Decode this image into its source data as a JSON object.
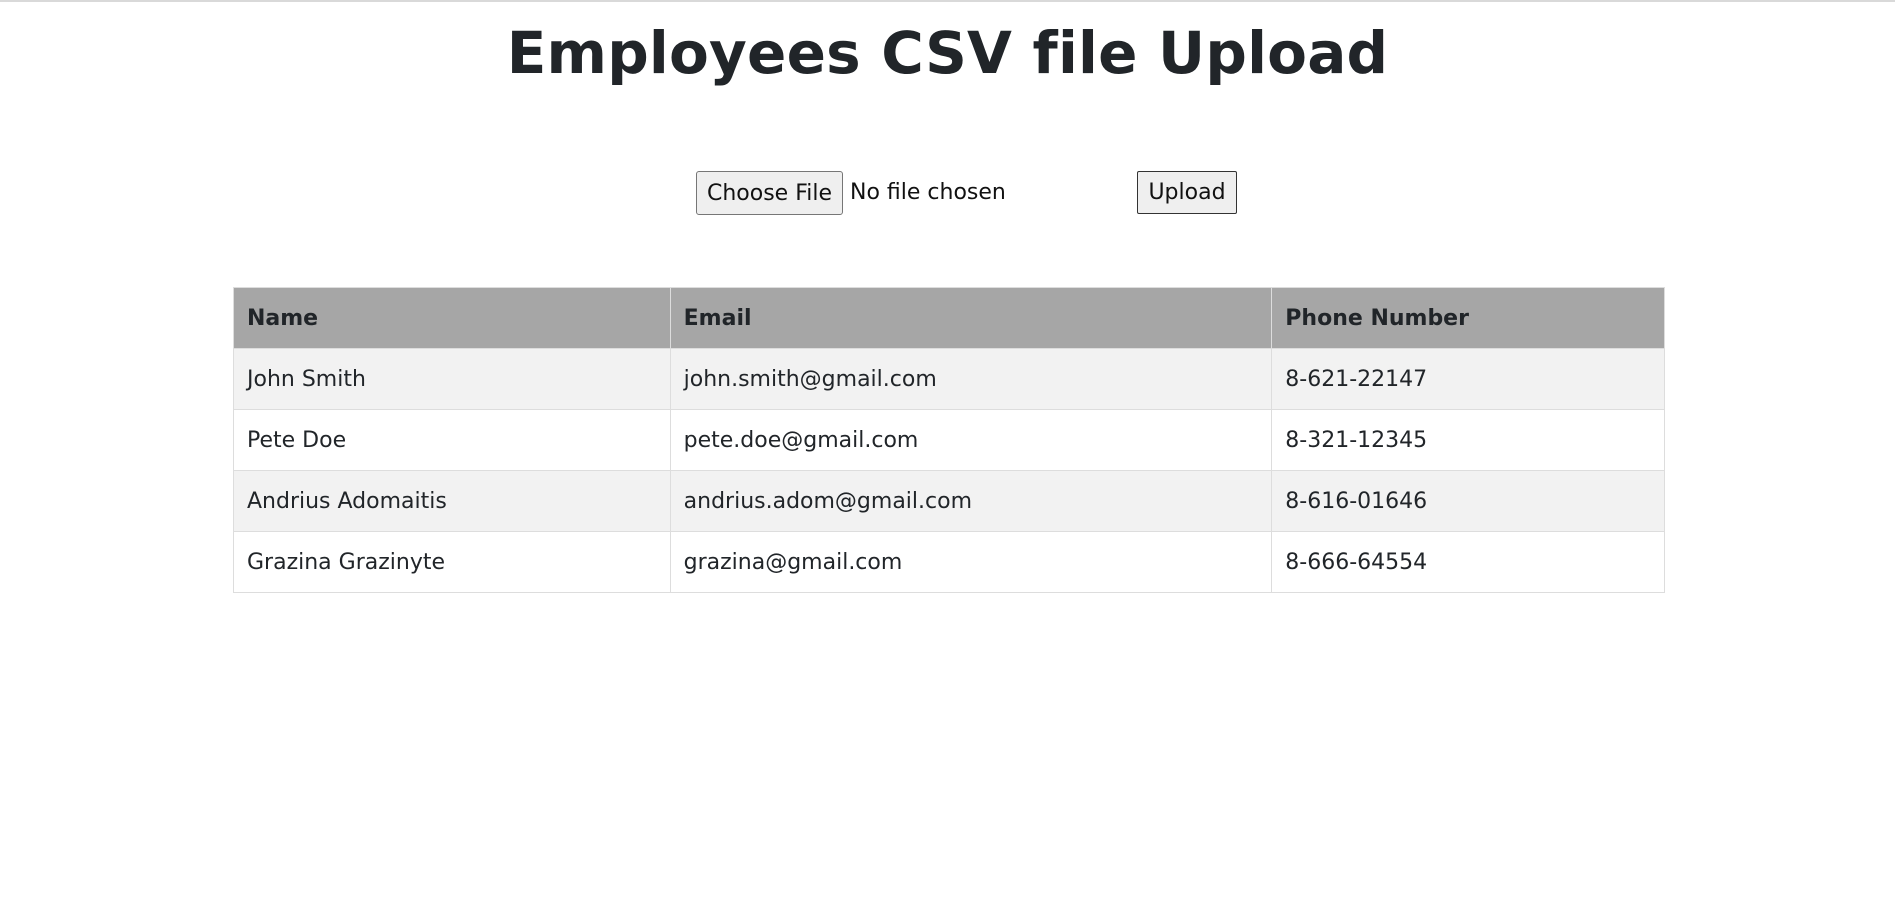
{
  "page": {
    "title": "Employees CSV file Upload"
  },
  "upload": {
    "choose_file_label": "Choose File",
    "file_status": "No file chosen",
    "upload_label": "Upload"
  },
  "table": {
    "headers": {
      "name": "Name",
      "email": "Email",
      "phone": "Phone Number"
    },
    "rows": [
      {
        "name": "John Smith",
        "email": "john.smith@gmail.com",
        "phone": "8-621-22147"
      },
      {
        "name": "Pete Doe",
        "email": "pete.doe@gmail.com",
        "phone": "8-321-12345"
      },
      {
        "name": "Andrius Adomaitis",
        "email": "andrius.adom@gmail.com",
        "phone": "8-616-01646"
      },
      {
        "name": "Grazina Grazinyte",
        "email": "grazina@gmail.com",
        "phone": "8-666-64554"
      }
    ]
  }
}
